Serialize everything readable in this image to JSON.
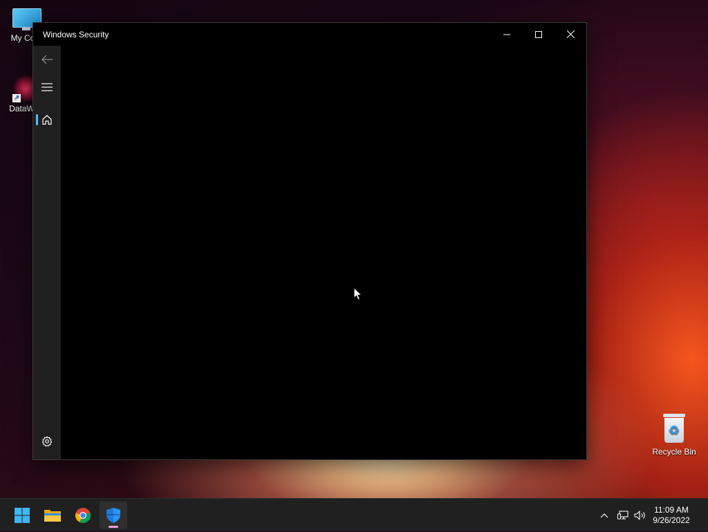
{
  "desktop": {
    "icons": [
      {
        "label": "My Com"
      },
      {
        "label": "DataWag"
      },
      {
        "label": "Recycle Bin"
      }
    ]
  },
  "window": {
    "title": "Windows Security",
    "controls": {
      "minimize": "minimize-icon",
      "maximize": "maximize-icon",
      "close": "close-icon"
    }
  },
  "sidebar": {
    "items": [
      {
        "icon": "back-arrow-icon"
      },
      {
        "icon": "hamburger-menu-icon"
      },
      {
        "icon": "home-icon",
        "selected": true
      },
      {
        "icon": "gear-icon"
      }
    ]
  },
  "taskbar": {
    "apps": [
      {
        "icon": "windows-start-icon"
      },
      {
        "icon": "file-explorer-icon"
      },
      {
        "icon": "chrome-icon"
      },
      {
        "icon": "windows-security-shield-icon",
        "active": true
      }
    ],
    "tray": {
      "icons": [
        "chevron-up-icon",
        "network-icon",
        "volume-icon"
      ]
    },
    "clock": {
      "time": "11:09 AM",
      "date": "9/26/2022"
    }
  },
  "colors": {
    "accent": "#4cc2ff",
    "sidebar": "#1f1f1f",
    "content": "#000000",
    "taskbar": "#202020"
  }
}
